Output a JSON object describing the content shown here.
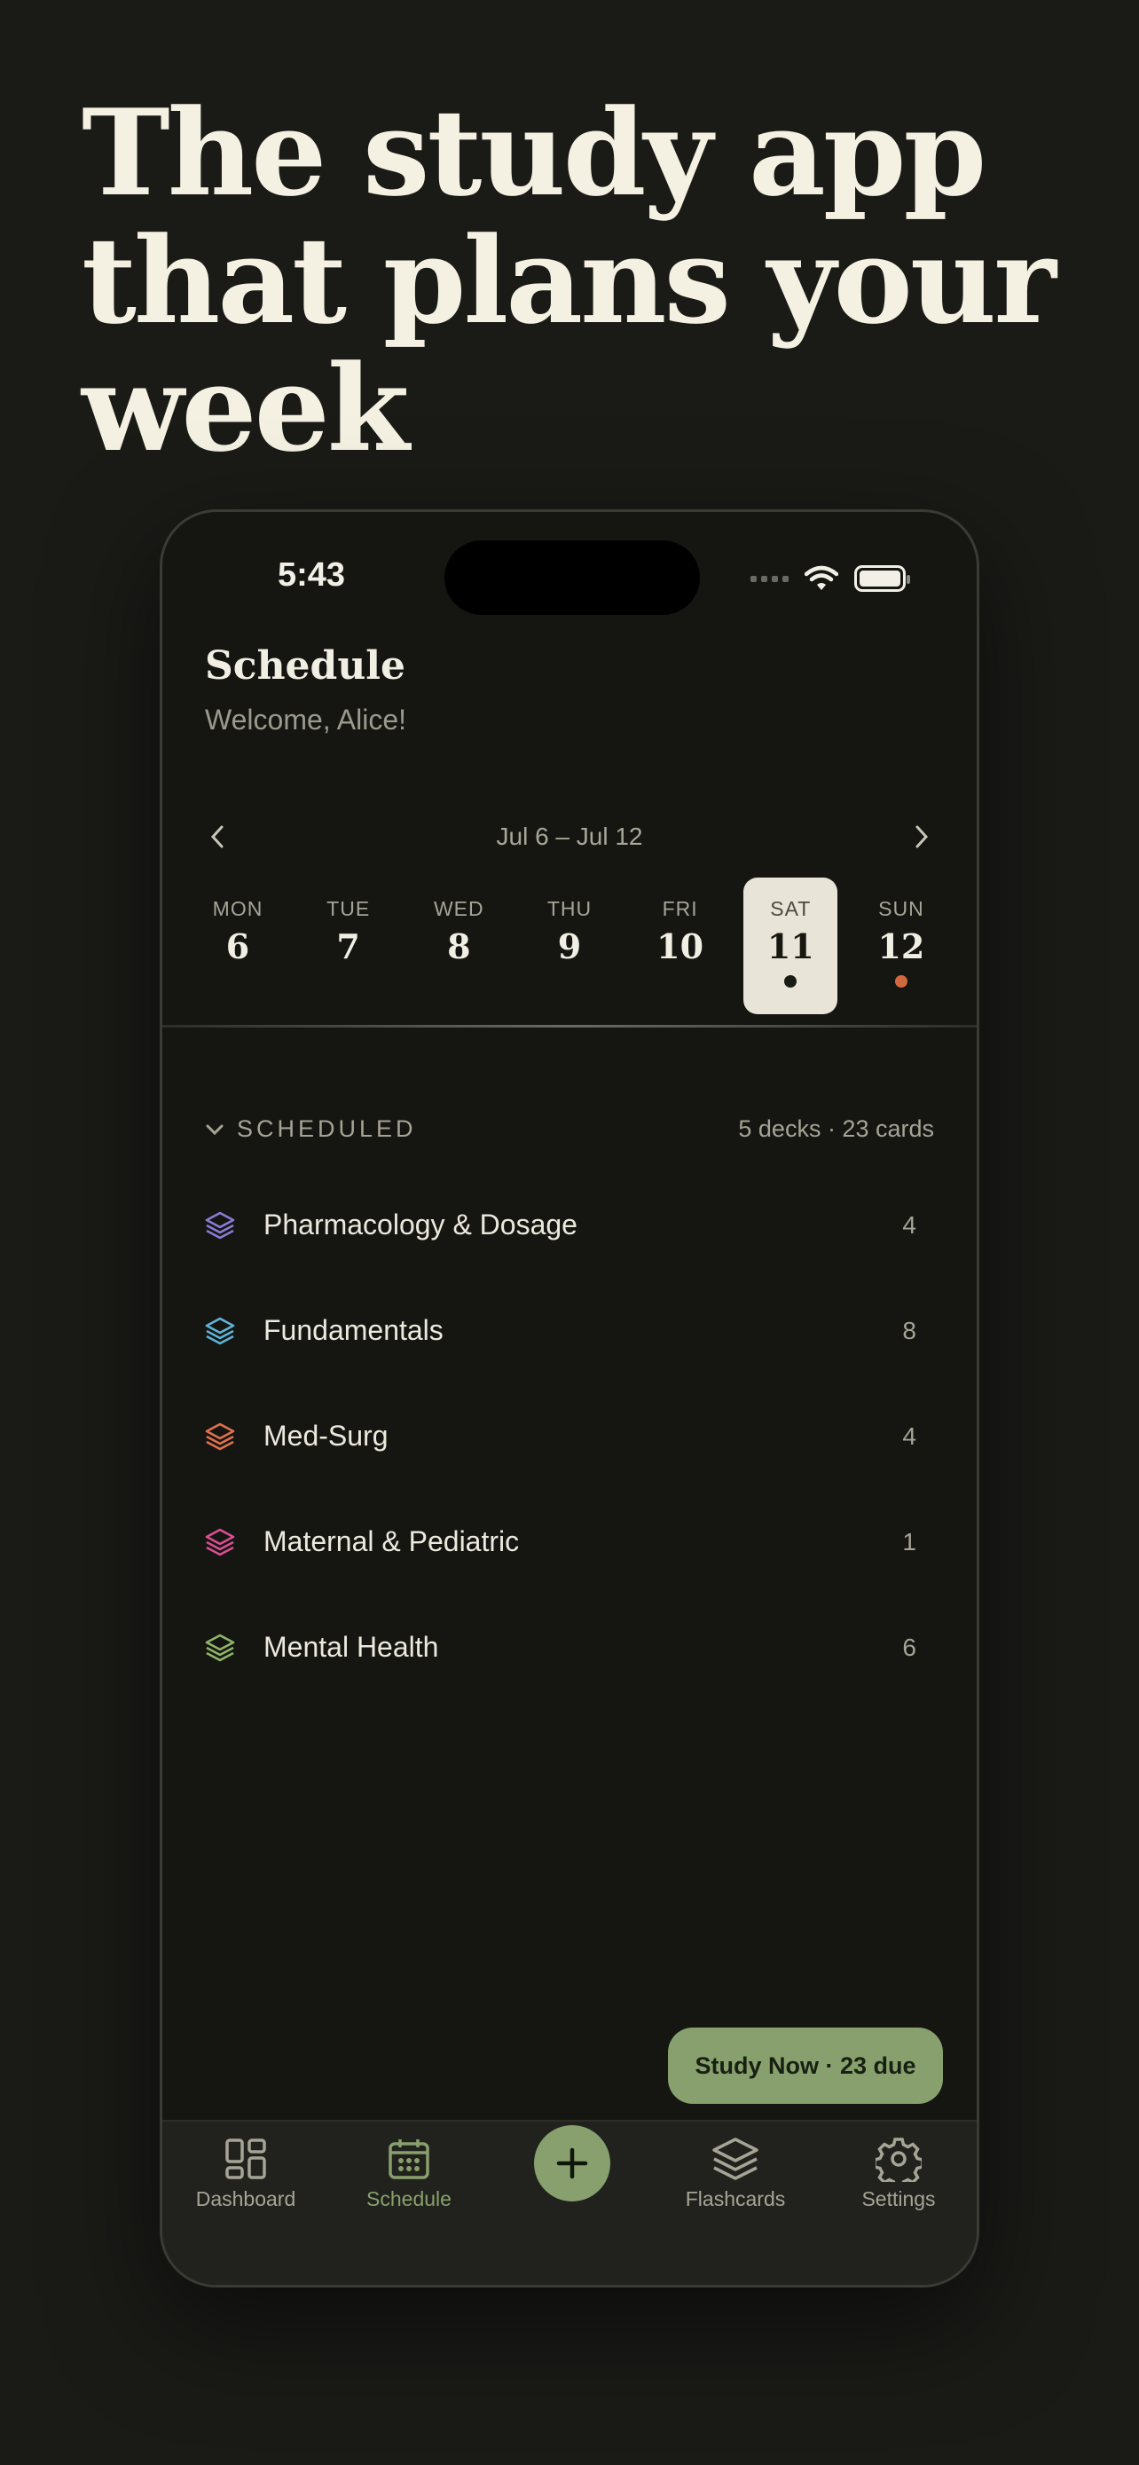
{
  "hero": {
    "line1": "The study app",
    "line2": "that plans your",
    "line3": "week"
  },
  "status": {
    "time": "5:43"
  },
  "header": {
    "title": "Schedule",
    "subtitle": "Welcome, Alice!"
  },
  "week": {
    "range": "Jul 6 – Jul 12",
    "days": [
      {
        "name": "MON",
        "date": "6"
      },
      {
        "name": "TUE",
        "date": "7"
      },
      {
        "name": "WED",
        "date": "8"
      },
      {
        "name": "THU",
        "date": "9"
      },
      {
        "name": "FRI",
        "date": "10"
      },
      {
        "name": "SAT",
        "date": "11",
        "selected": true,
        "dot": "#1a1b17"
      },
      {
        "name": "SUN",
        "date": "12",
        "dot": "#d0693e"
      }
    ]
  },
  "scheduled": {
    "label": "SCHEDULED",
    "summary": "5 decks · 23 cards",
    "decks": [
      {
        "name": "Pharmacology & Dosage",
        "count": "4",
        "color": "#8b7bd8"
      },
      {
        "name": "Fundamentals",
        "count": "8",
        "color": "#5fb3d9"
      },
      {
        "name": "Med-Surg",
        "count": "4",
        "color": "#e0714f"
      },
      {
        "name": "Maternal & Pediatric",
        "count": "1",
        "color": "#d94f92"
      },
      {
        "name": "Mental Health",
        "count": "6",
        "color": "#8fb56a"
      }
    ]
  },
  "study_button": "Study Now · 23 due",
  "tabs": {
    "dashboard": "Dashboard",
    "schedule": "Schedule",
    "flashcards": "Flashcards",
    "settings": "Settings"
  },
  "colors": {
    "accent": "#88a06d",
    "background": "#151612"
  }
}
